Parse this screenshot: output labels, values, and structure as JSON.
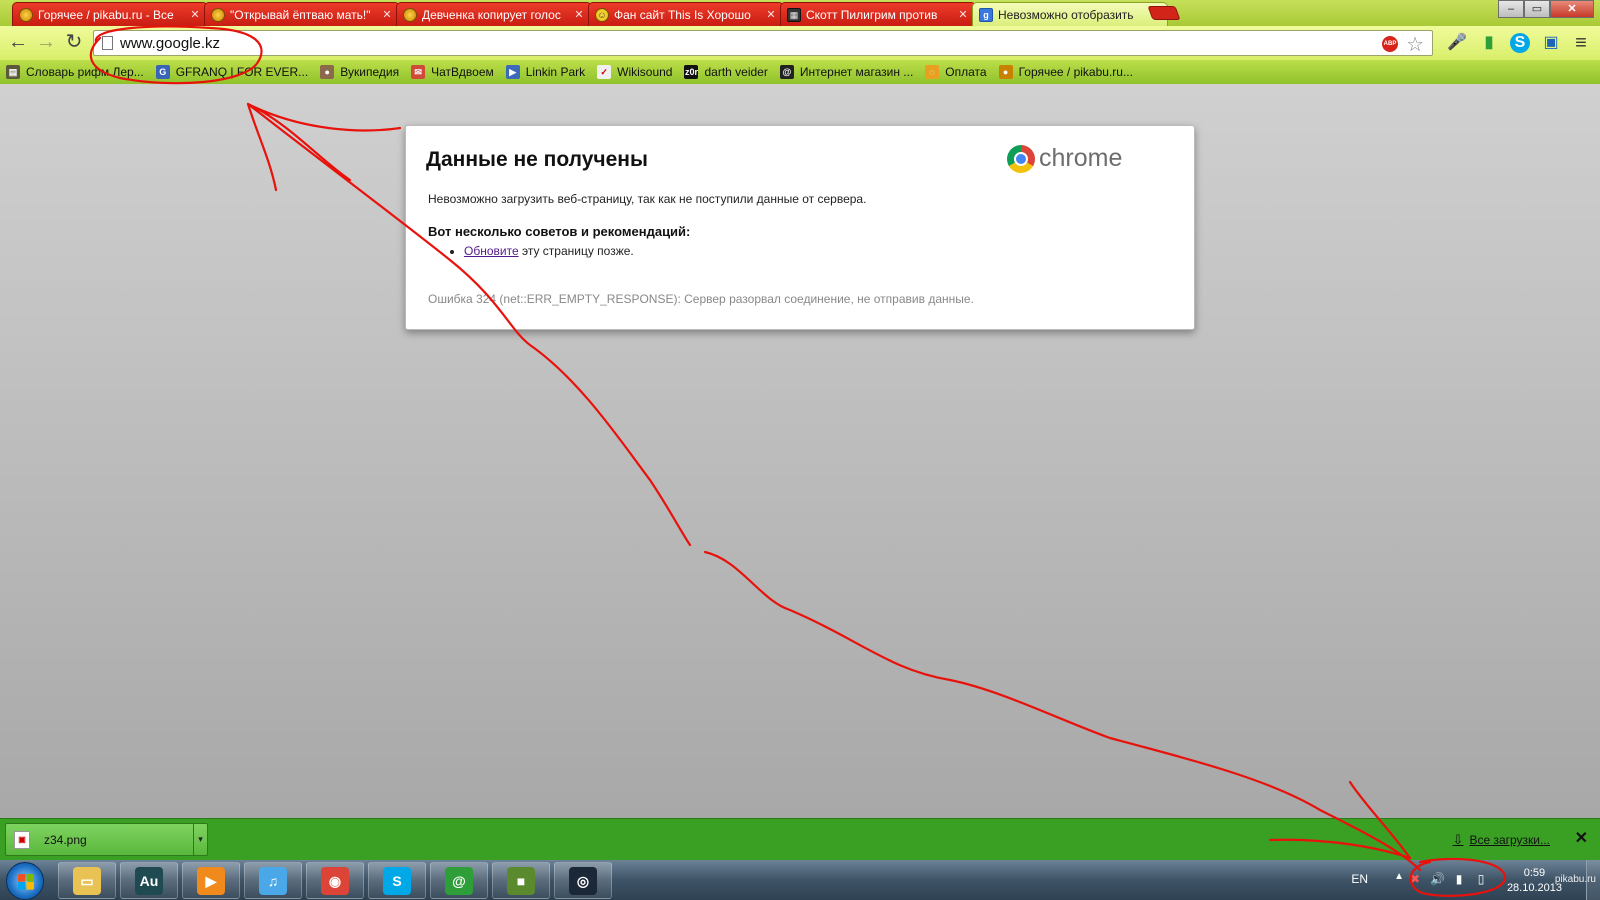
{
  "tabs": [
    {
      "title": "Горячее / pikabu.ru - Все",
      "icon": "pikabu-icon",
      "active": false
    },
    {
      "title": "\"Открывай ёптваю мать!\"",
      "icon": "pikabu-icon",
      "active": false
    },
    {
      "title": "Девченка копирует голос",
      "icon": "pikabu-icon",
      "active": false
    },
    {
      "title": "Фан сайт This Is Хорошо",
      "icon": "smiley-icon",
      "active": false
    },
    {
      "title": "Скотт Пилигрим против",
      "icon": "clapperboard-icon",
      "active": false
    },
    {
      "title": "Невозможно отобразить",
      "icon": "google-icon",
      "active": true
    }
  ],
  "window_buttons": {
    "minimize": "–",
    "maximize": "▭",
    "close": "✕"
  },
  "toolbar": {
    "back": "←",
    "forward": "→",
    "reload": "↻",
    "url": "www.google.kz",
    "abp_label": "ABP",
    "star": "☆",
    "menu": "≡"
  },
  "bookmarks": [
    {
      "label": "Словарь рифм Лер...",
      "icon": "book-icon",
      "glyph": "▤"
    },
    {
      "label": "GFRANQ | FOR EVER...",
      "icon": "gfranq-icon",
      "glyph": "G"
    },
    {
      "label": "Вукипедия",
      "icon": "wookiepedia-icon",
      "glyph": "●"
    },
    {
      "label": "ЧатВдвоем",
      "icon": "chat-icon",
      "glyph": "✉"
    },
    {
      "label": "Linkin Park",
      "icon": "play-icon",
      "glyph": "▶"
    },
    {
      "label": "Wikisound",
      "icon": "wikisound-icon",
      "glyph": "✓"
    },
    {
      "label": "darth veider",
      "icon": "z0r-icon",
      "glyph": "z0r"
    },
    {
      "label": "Интернет магазин ...",
      "icon": "shop-icon",
      "glyph": "@"
    },
    {
      "label": "Оплата",
      "icon": "payment-icon",
      "glyph": "◌"
    },
    {
      "label": "Горячее / pikabu.ru...",
      "icon": "pikabu-icon",
      "glyph": "●"
    }
  ],
  "error": {
    "title": "Данные не получены",
    "brand": "chrome",
    "message": "Невозможно загрузить веб-страницу, так как не поступили данные от сервера.",
    "tips_heading": "Вот несколько советов и рекомендаций:",
    "tip_link": "Обновите",
    "tip_rest": " эту страницу позже.",
    "code": "Ошибка 324 (net::ERR_EMPTY_RESPONSE): Сервер разорвал соединение, не отправив данные."
  },
  "downloads": {
    "file_name": "z34.png",
    "all_downloads": "Все загрузки...",
    "close": "✕"
  },
  "taskbar": {
    "apps": [
      {
        "name": "explorer-icon",
        "glyph": "▭",
        "color": "#e8c354"
      },
      {
        "name": "audition-icon",
        "glyph": "Au",
        "color": "#1f4a52"
      },
      {
        "name": "media-player-icon",
        "glyph": "▶",
        "color": "#f08a1c"
      },
      {
        "name": "music-icon",
        "glyph": "♫",
        "color": "#4aa8e8"
      },
      {
        "name": "chrome-icon",
        "glyph": "◉",
        "color": "#db4437"
      },
      {
        "name": "skype-icon",
        "glyph": "S",
        "color": "#00a8e8"
      },
      {
        "name": "icq-icon",
        "glyph": "@",
        "color": "#2e9e38"
      },
      {
        "name": "minecraft-icon",
        "glyph": "■",
        "color": "#5b8a2e"
      },
      {
        "name": "steam-icon",
        "glyph": "◎",
        "color": "#1b2838"
      }
    ],
    "lang": "EN",
    "tray_up": "▲",
    "time": "0:59",
    "date": "28.10.2013",
    "watermark": "pikabu.ru"
  }
}
